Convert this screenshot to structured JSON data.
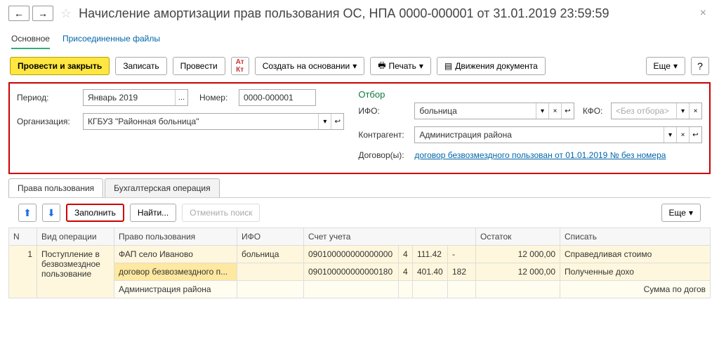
{
  "header": {
    "title": "Начисление амортизации прав пользования ОС, НПА 0000-000001 от 31.01.2019 23:59:59",
    "nav_main": "Основное",
    "nav_files": "Присоединенные файлы"
  },
  "toolbar": {
    "post_close": "Провести и закрыть",
    "save": "Записать",
    "post": "Провести",
    "based_on": "Создать на основании",
    "print": "Печать",
    "movements": "Движения документа",
    "more": "Еще"
  },
  "form": {
    "period_label": "Период:",
    "period_value": "Январь 2019",
    "number_label": "Номер:",
    "number_value": "0000-000001",
    "org_label": "Организация:",
    "org_value": "КГБУЗ \"Районная больница\"",
    "otbor_title": "Отбор",
    "ifo_label": "ИФО:",
    "ifo_value": "больница",
    "kfo_label": "КФО:",
    "kfo_placeholder": "<Без отбора>",
    "kontr_label": "Контрагент:",
    "kontr_value": "Администрация  района",
    "dogovor_label": "Договор(ы):",
    "dogovor_link": "договор безвозмездного пользован от 01.01.2019 № без номера"
  },
  "tabs": {
    "t1": "Права пользования",
    "t2": "Бухгалтерская операция"
  },
  "table_toolbar": {
    "fill": "Заполнить",
    "find": "Найти...",
    "cancel_find": "Отменить поиск",
    "more": "Еще"
  },
  "columns": {
    "n": "N",
    "op": "Вид операции",
    "right": "Право пользования",
    "ifo": "ИФО",
    "account": "Счет учета",
    "rest": "Остаток",
    "writeoff": "Списать"
  },
  "rows": [
    {
      "n": "1",
      "op": "Поступление в безвозмездное пользование",
      "right": "ФАП село Иваново",
      "ifo": "больница",
      "account": "090100000000000000",
      "sub1": "4",
      "sub2": "111.42",
      "rest": "-",
      "writeoff": "12 000,00",
      "comment": "Справедливая стоимо"
    },
    {
      "right": "договор безвозмездного п...",
      "account": "090100000000000180",
      "sub1": "4",
      "sub2": "401.40",
      "sub3": "182",
      "writeoff": "12 000,00",
      "comment": "Полученные дохо"
    },
    {
      "right": "Администрация  района",
      "comment": "Сумма по догов"
    }
  ]
}
